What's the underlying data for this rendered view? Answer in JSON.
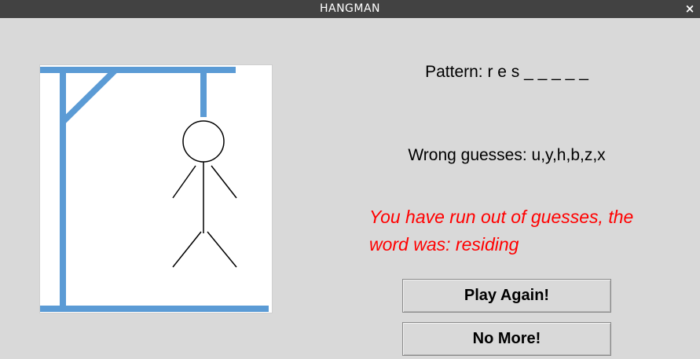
{
  "window": {
    "title": "HANGMAN",
    "close_label": "×"
  },
  "game": {
    "pattern_text": "Pattern: r e s _ _ _ _ _",
    "wrong_text": "Wrong guesses: u,y,h,b,z,x",
    "message": "You have run out of guesses, the word was: residing",
    "message_color": "#ff0000",
    "gallows_color": "#5b9bd5"
  },
  "buttons": {
    "play_again": "Play Again!",
    "no_more": "No More!"
  }
}
